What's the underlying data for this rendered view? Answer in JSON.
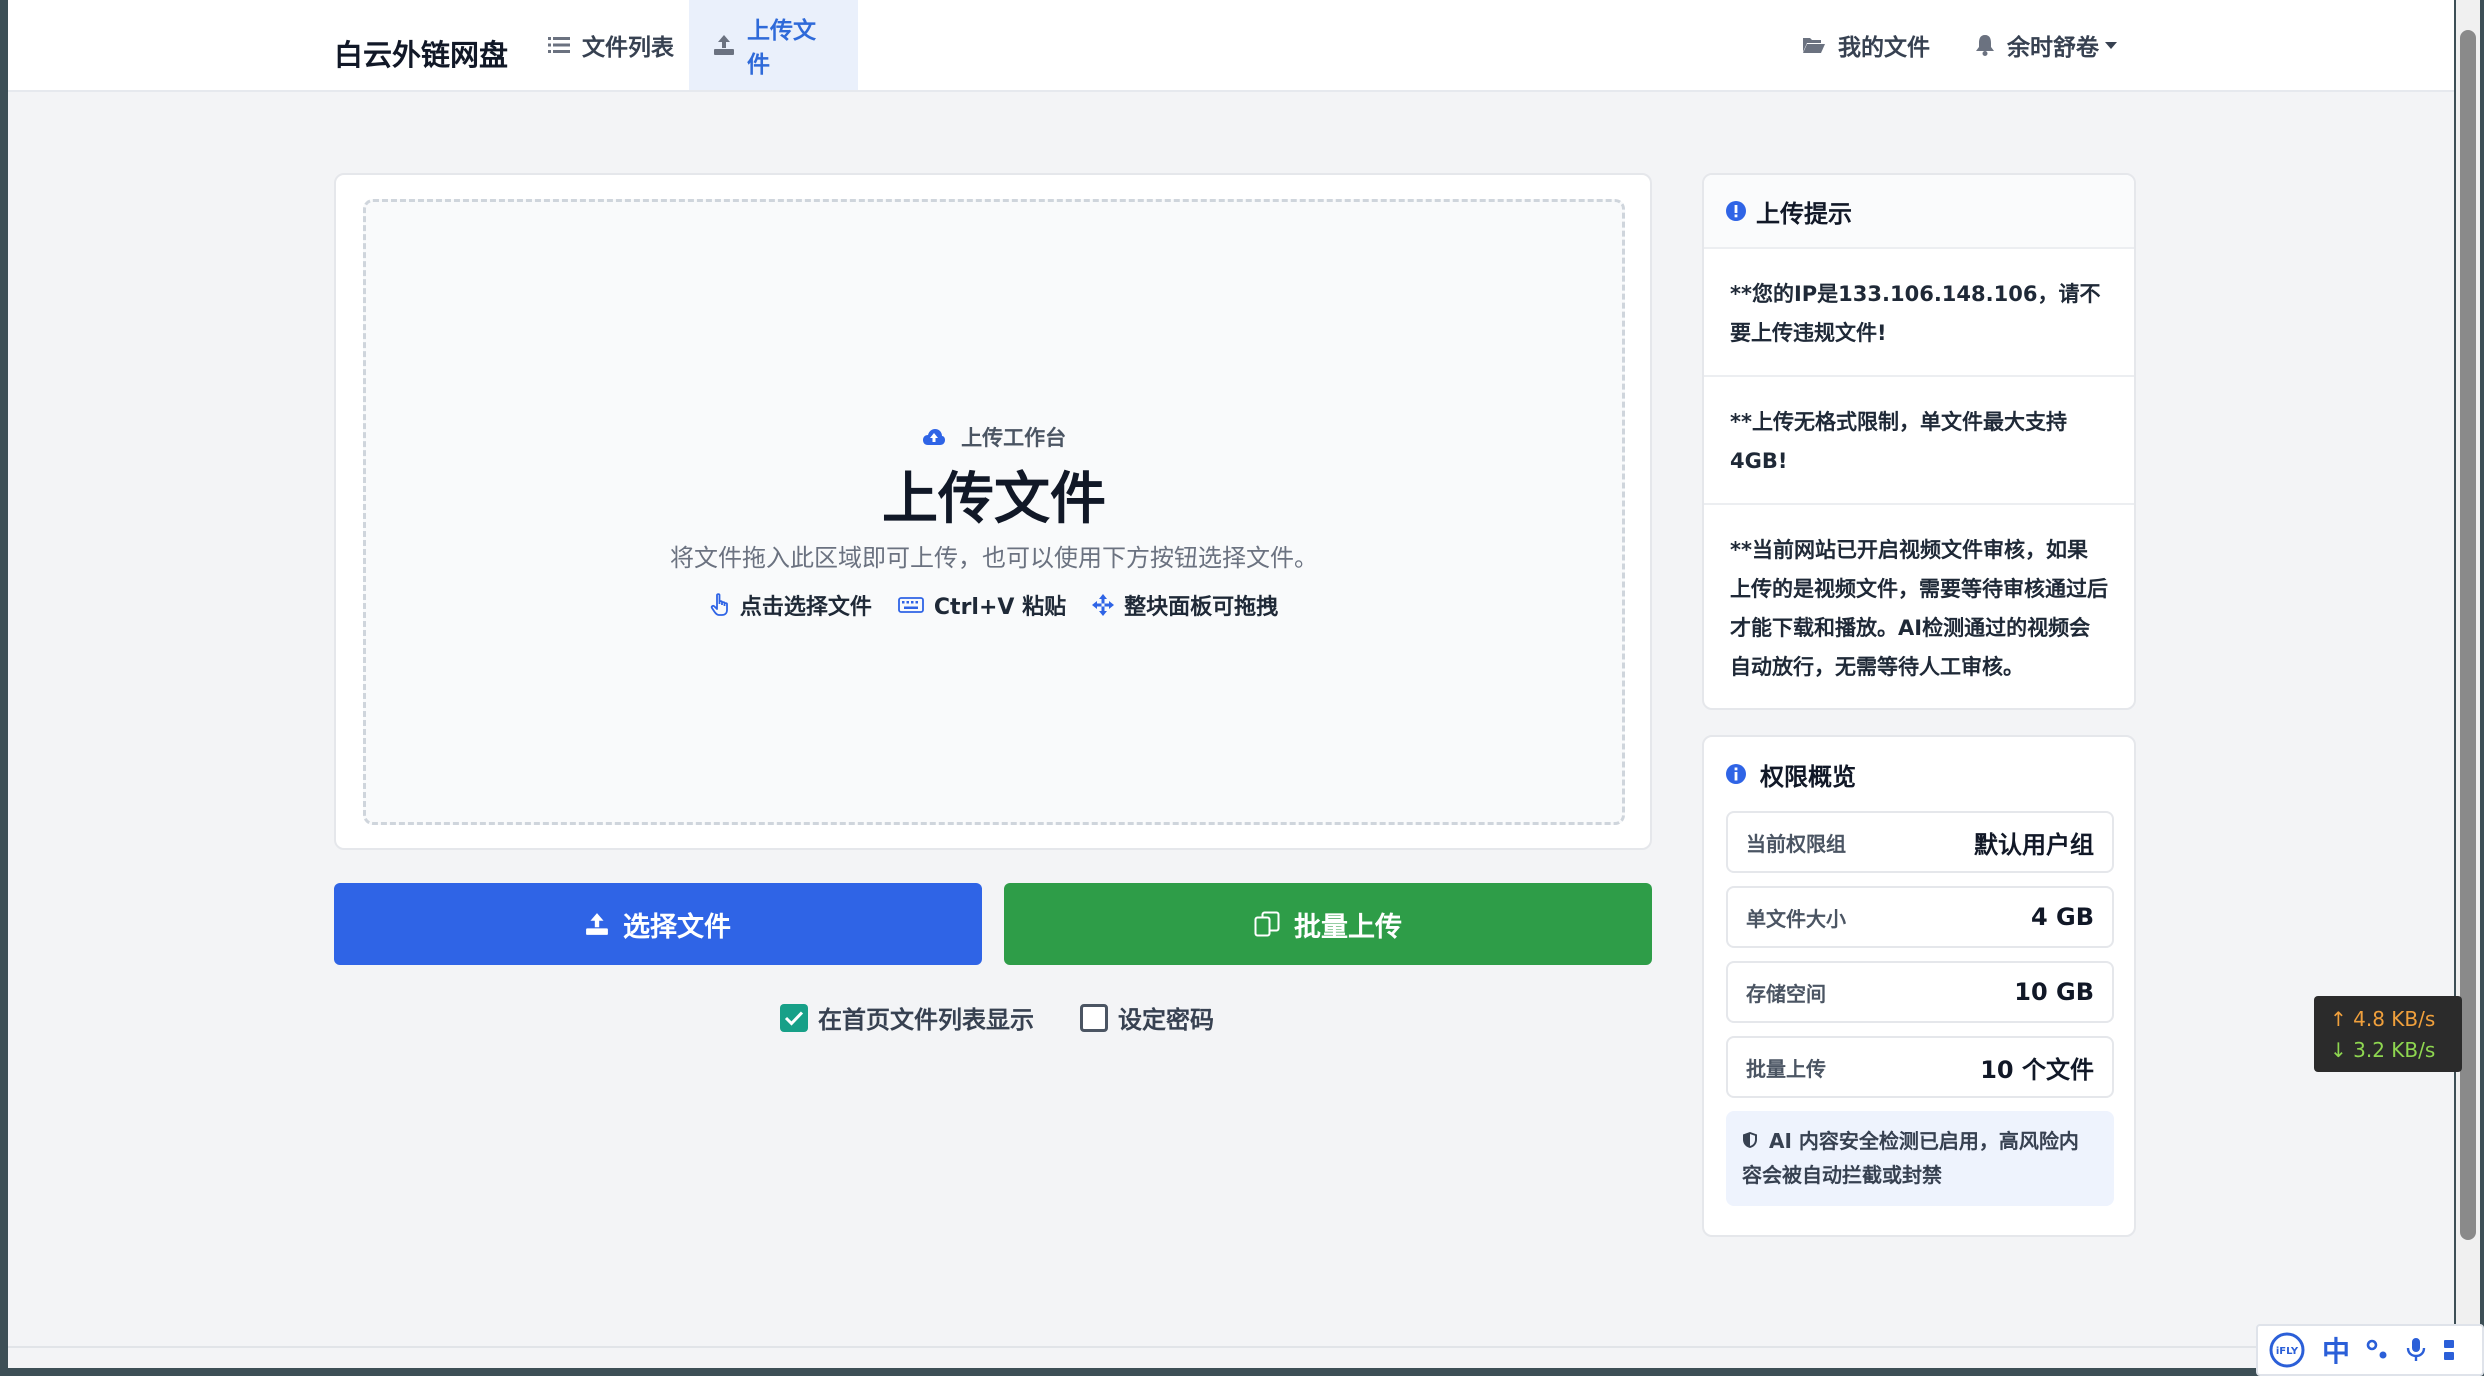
{
  "navbar": {
    "brand": "白云外链网盘",
    "files_tab": "文件列表",
    "upload_tab": "上传文件",
    "my_files": "我的文件",
    "user_name": "余时舒卷"
  },
  "dropzone": {
    "kicker": "上传工作台",
    "title": "上传文件",
    "description": "将文件拖入此区域即可上传，也可以使用下方按钮选择文件。",
    "hint_click": "点击选择文件",
    "hint_paste": "Ctrl+V 粘贴",
    "hint_drag": "整块面板可拖拽"
  },
  "actions": {
    "select_label": "选择文件",
    "batch_label": "批量上传",
    "show_on_home_label": "在首页文件列表显示",
    "show_on_home_checked": true,
    "set_password_label": "设定密码",
    "set_password_checked": false
  },
  "tips": {
    "title": "上传提示",
    "items": [
      "**您的IP是133.106.148.106，请不要上传违规文件!",
      "**上传无格式限制，单文件最大支持4GB!",
      "**当前网站已开启视频文件审核，如果上传的是视频文件，需要等待审核通过后才能下载和播放。AI检测通过的视频会自动放行，无需等待人工审核。"
    ]
  },
  "permissions": {
    "title": "权限概览",
    "rows": [
      {
        "label": "当前权限组",
        "value": "默认用户组"
      },
      {
        "label": "单文件大小",
        "value": "4 GB"
      },
      {
        "label": "存储空间",
        "value": "10 GB"
      },
      {
        "label": "批量上传",
        "value": "10 个文件"
      }
    ],
    "ai_note": "AI 内容安全检测已启用，高风险内容会被自动拦截或封禁"
  },
  "speed_widget": {
    "up": "↑ 4.8 KB/s",
    "down": "↓ 3.2 KB/s"
  },
  "ime": {
    "logo": "iFLY",
    "mode": "中"
  },
  "colors": {
    "primary": "#2f64e6",
    "success": "#2e9d48",
    "active_tab_bg": "#eaf0fb",
    "checkbox_on": "#17a088"
  }
}
